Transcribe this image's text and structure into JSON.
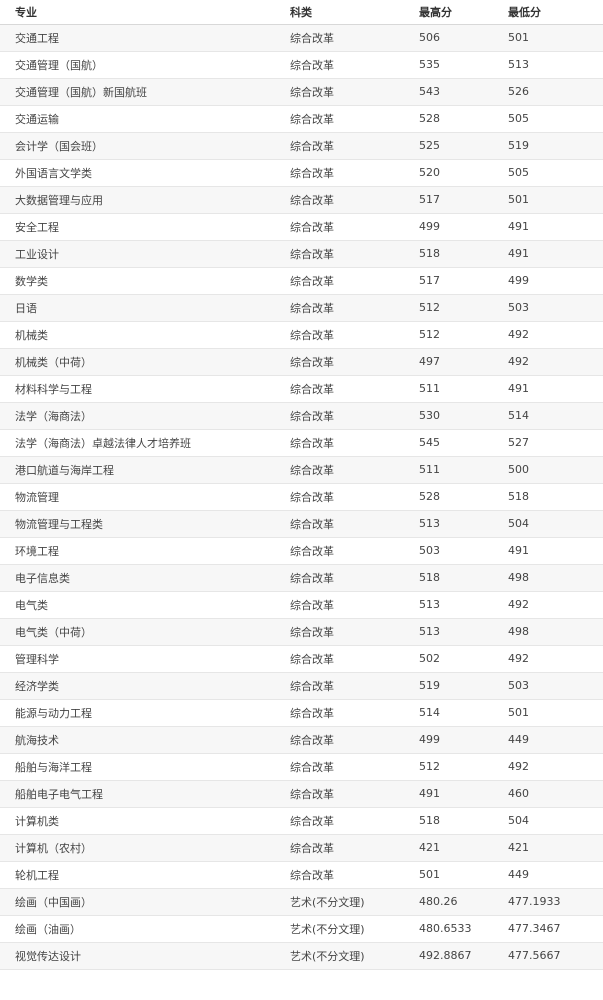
{
  "table": {
    "headers": {
      "major": "专业",
      "category": "科类",
      "max": "最高分",
      "min": "最低分"
    },
    "rows": [
      {
        "major": "交通工程",
        "category": "综合改革",
        "max": "506",
        "min": "501"
      },
      {
        "major": "交通管理（国航）",
        "category": "综合改革",
        "max": "535",
        "min": "513"
      },
      {
        "major": "交通管理（国航）新国航班",
        "category": "综合改革",
        "max": "543",
        "min": "526"
      },
      {
        "major": "交通运输",
        "category": "综合改革",
        "max": "528",
        "min": "505"
      },
      {
        "major": "会计学（国会班）",
        "category": "综合改革",
        "max": "525",
        "min": "519"
      },
      {
        "major": "外国语言文学类",
        "category": "综合改革",
        "max": "520",
        "min": "505"
      },
      {
        "major": "大数据管理与应用",
        "category": "综合改革",
        "max": "517",
        "min": "501"
      },
      {
        "major": "安全工程",
        "category": "综合改革",
        "max": "499",
        "min": "491"
      },
      {
        "major": "工业设计",
        "category": "综合改革",
        "max": "518",
        "min": "491"
      },
      {
        "major": "数学类",
        "category": "综合改革",
        "max": "517",
        "min": "499"
      },
      {
        "major": "日语",
        "category": "综合改革",
        "max": "512",
        "min": "503"
      },
      {
        "major": "机械类",
        "category": "综合改革",
        "max": "512",
        "min": "492"
      },
      {
        "major": "机械类（中荷）",
        "category": "综合改革",
        "max": "497",
        "min": "492"
      },
      {
        "major": "材料科学与工程",
        "category": "综合改革",
        "max": "511",
        "min": "491"
      },
      {
        "major": "法学（海商法）",
        "category": "综合改革",
        "max": "530",
        "min": "514"
      },
      {
        "major": "法学（海商法）卓越法律人才培养班",
        "category": "综合改革",
        "max": "545",
        "min": "527"
      },
      {
        "major": "港口航道与海岸工程",
        "category": "综合改革",
        "max": "511",
        "min": "500"
      },
      {
        "major": "物流管理",
        "category": "综合改革",
        "max": "528",
        "min": "518"
      },
      {
        "major": "物流管理与工程类",
        "category": "综合改革",
        "max": "513",
        "min": "504"
      },
      {
        "major": "环境工程",
        "category": "综合改革",
        "max": "503",
        "min": "491"
      },
      {
        "major": "电子信息类",
        "category": "综合改革",
        "max": "518",
        "min": "498"
      },
      {
        "major": "电气类",
        "category": "综合改革",
        "max": "513",
        "min": "492"
      },
      {
        "major": "电气类（中荷）",
        "category": "综合改革",
        "max": "513",
        "min": "498"
      },
      {
        "major": "管理科学",
        "category": "综合改革",
        "max": "502",
        "min": "492"
      },
      {
        "major": "经济学类",
        "category": "综合改革",
        "max": "519",
        "min": "503"
      },
      {
        "major": "能源与动力工程",
        "category": "综合改革",
        "max": "514",
        "min": "501"
      },
      {
        "major": "航海技术",
        "category": "综合改革",
        "max": "499",
        "min": "449"
      },
      {
        "major": "船舶与海洋工程",
        "category": "综合改革",
        "max": "512",
        "min": "492"
      },
      {
        "major": "船舶电子电气工程",
        "category": "综合改革",
        "max": "491",
        "min": "460"
      },
      {
        "major": "计算机类",
        "category": "综合改革",
        "max": "518",
        "min": "504"
      },
      {
        "major": "计算机（农村）",
        "category": "综合改革",
        "max": "421",
        "min": "421"
      },
      {
        "major": "轮机工程",
        "category": "综合改革",
        "max": "501",
        "min": "449"
      },
      {
        "major": "绘画（中国画）",
        "category": "艺术(不分文理)",
        "max": "480.26",
        "min": "477.1933"
      },
      {
        "major": "绘画（油画）",
        "category": "艺术(不分文理)",
        "max": "480.6533",
        "min": "477.3467"
      },
      {
        "major": "视觉传达设计",
        "category": "艺术(不分文理)",
        "max": "492.8867",
        "min": "477.5667"
      }
    ]
  }
}
